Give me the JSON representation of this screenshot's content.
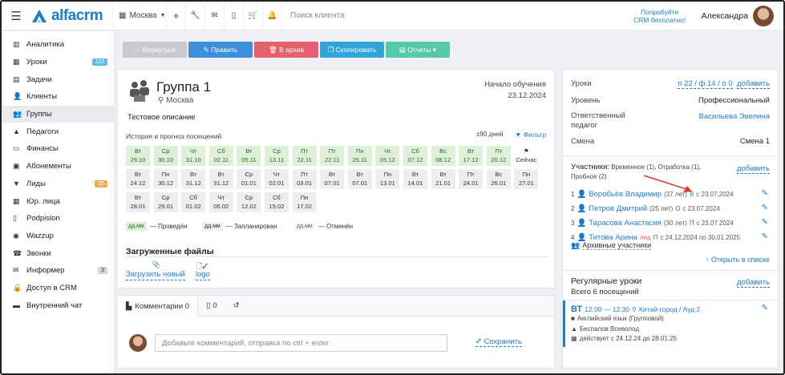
{
  "header": {
    "logo_text": "alfacrm",
    "city": "Москва",
    "search_placeholder": "Поиск клиента",
    "promo_line1": "Попробуйте",
    "promo_line2": "CRM бесплатно!",
    "user_name": "Александра"
  },
  "sidebar": {
    "items": [
      {
        "label": "Аналитика",
        "icon": "chart-icon"
      },
      {
        "label": "Уроки",
        "icon": "calendar-icon",
        "badge": "112"
      },
      {
        "label": "Задачи",
        "icon": "clipboard-icon"
      },
      {
        "label": "Клиенты",
        "icon": "user-icon"
      },
      {
        "label": "Группы",
        "icon": "users-icon"
      },
      {
        "label": "Педагоги",
        "icon": "graduation-cap-icon"
      },
      {
        "label": "Финансы",
        "icon": "money-icon"
      },
      {
        "label": "Абонементы",
        "icon": "ticket-icon"
      },
      {
        "label": "Лиды",
        "icon": "funnel-icon",
        "badge": "25"
      },
      {
        "label": "Юр. лица",
        "icon": "building-icon"
      },
      {
        "label": "Podpislon",
        "icon": "document-icon"
      },
      {
        "label": "Wazzup",
        "icon": "whatsapp-icon"
      },
      {
        "label": "Звонки",
        "icon": "phone-icon"
      },
      {
        "label": "Информер",
        "icon": "mail-icon",
        "badge": "3"
      },
      {
        "label": "Доступ в CRM",
        "icon": "lock-icon"
      },
      {
        "label": "Внутренний чат",
        "icon": "chat-icon"
      }
    ]
  },
  "actions": {
    "back": "← Вернуться",
    "edit": "✎ Править",
    "archive": "🗑 В архив",
    "copy": "❐ Скопировать",
    "reports": "▤ Отчеты ▾"
  },
  "group": {
    "title": "Группа 1",
    "city": "Москва",
    "start_label": "Начало обучения",
    "start_date": "23.12.2024",
    "description": "Тестовое описание",
    "history_label": "История и прогноз посещений",
    "days_label": "±90 дней",
    "filter_label": "Фильтр",
    "now_label": "Сейчас",
    "done_row": [
      {
        "d": "Вт",
        "dt": "29.10"
      },
      {
        "d": "Ср",
        "dt": "30.10"
      },
      {
        "d": "Чт",
        "dt": "31.10"
      },
      {
        "d": "Сб",
        "dt": "02.11"
      },
      {
        "d": "Вт",
        "dt": "05.11"
      },
      {
        "d": "Ср",
        "dt": "13.11"
      },
      {
        "d": "Пт",
        "dt": "22.11"
      },
      {
        "d": "Пт",
        "dt": "22.11"
      },
      {
        "d": "Пн",
        "dt": "25.11"
      },
      {
        "d": "Чт",
        "dt": "05.12"
      },
      {
        "d": "Сб",
        "dt": "07.12"
      },
      {
        "d": "Вс",
        "dt": "08.12"
      },
      {
        "d": "Вт",
        "dt": "17.12"
      },
      {
        "d": "Пт",
        "dt": "20.12"
      }
    ],
    "plan_rows": [
      [
        {
          "d": "Вт",
          "dt": "24.12"
        },
        {
          "d": "Пн",
          "dt": "30.12"
        },
        {
          "d": "Вт",
          "dt": "31.12"
        },
        {
          "d": "Вт",
          "dt": "31.12"
        },
        {
          "d": "Ср",
          "dt": "01.01"
        },
        {
          "d": "Чт",
          "dt": "02.01"
        },
        {
          "d": "Пт",
          "dt": "03.01"
        },
        {
          "d": "Вт",
          "dt": "07.01"
        },
        {
          "d": "Вт",
          "dt": "07.01"
        },
        {
          "d": "Пн",
          "dt": "13.01"
        },
        {
          "d": "Вт",
          "dt": "14.01"
        },
        {
          "d": "Вт",
          "dt": "21.01"
        },
        {
          "d": "Пт",
          "dt": "24.01"
        },
        {
          "d": "Вс",
          "dt": "26.01"
        },
        {
          "d": "Пн",
          "dt": "27.01"
        }
      ],
      [
        {
          "d": "Вт",
          "dt": "28.01"
        },
        {
          "d": "Ср",
          "dt": "29.01"
        },
        {
          "d": "Сб",
          "dt": "01.02"
        },
        {
          "d": "Чт",
          "dt": "06.02"
        },
        {
          "d": "Ср",
          "dt": "12.02"
        },
        {
          "d": "Сб",
          "dt": "15.02"
        },
        {
          "d": "Пн",
          "dt": "17.02"
        }
      ]
    ],
    "legend": [
      {
        "box": "дд.мм",
        "text": "— Проведён",
        "kind": "done"
      },
      {
        "box": "дд.мм",
        "text": "— Запланирован",
        "kind": "plan"
      },
      {
        "box": "дд.мм",
        "text": "— Отменён",
        "kind": "cancel"
      }
    ],
    "files_title": "Загруженные файлы",
    "upload_label": "Загрузить новый",
    "file_name": "logo"
  },
  "comments": {
    "tab_comments": "Комментарии 0",
    "tab_files": "0",
    "placeholder": "Добавьте комментарий, отправка по ctrl + enter",
    "save_label": "Сохранить"
  },
  "info": {
    "lessons_label": "Уроки",
    "lessons_value": "п 22 / ф 14 / о 0",
    "add_label": "добавить",
    "level_label": "Уровень",
    "level_value": "Профессиональный",
    "teacher_label": "Ответственный педагог",
    "teacher_value": "Васильева Эвелина",
    "shift_label": "Смена",
    "shift_value": "Смена 1",
    "participants_label": "Участники:",
    "participants_meta": "Временное (1), Отработка (1), Пробное (2)",
    "participants": [
      {
        "num": "1",
        "name": "Воробьёв Владимир",
        "age": "(37 лет)",
        "tag": "В",
        "since": "с 23.07.2024"
      },
      {
        "num": "2",
        "name": "Петров Дмитрий",
        "age": "(25 лет)",
        "tag": "О",
        "since": "с 23.07.2024"
      },
      {
        "num": "3",
        "name": "Тарасова Анастасия",
        "age": "(30 лет)",
        "tag": "П",
        "since": "с 23.07.2024"
      },
      {
        "num": "4",
        "name": "Титова Арина",
        "age": "лид",
        "tag": "П",
        "since": "с 24.12.2024 по 30.01.2025"
      }
    ],
    "archive_label": "Архивные участники",
    "open_list": "Открыть в списке",
    "regular_title": "Регулярные уроки",
    "regular_count": "Всего 6 посещений",
    "lesson_day": "ВТ",
    "lesson_time": "12:00 — 12:30",
    "lesson_place": "Китай-город / Ауд 2",
    "lesson_subject": "Английский язык (Групповой)",
    "lesson_teacher": "Беспалов Всеволод",
    "lesson_period": "действует с 24.12.24 до 28.01.25"
  },
  "colors": {
    "brand": "#1e7ccd",
    "back": "#c7c9cc",
    "edit": "#3d8fd9",
    "archive": "#e4606d",
    "copy": "#2ea6d9",
    "reports": "#56c9a6",
    "done_bg": "#dff0d8",
    "arrow": "#e03a2e"
  }
}
